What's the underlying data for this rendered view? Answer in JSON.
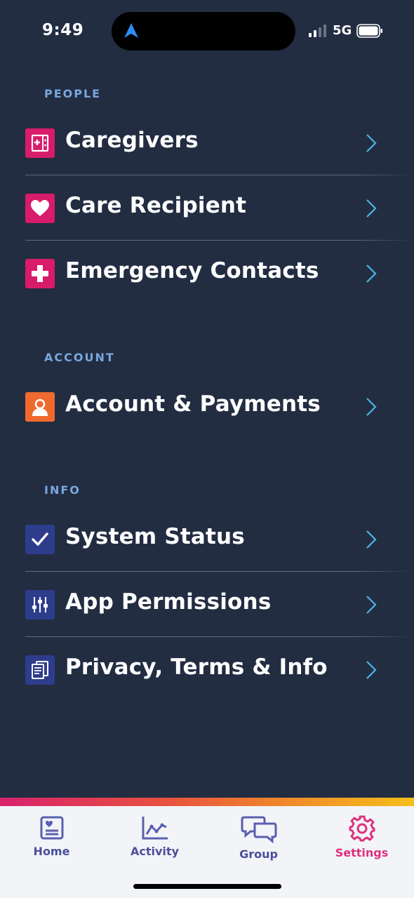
{
  "status_bar": {
    "time": "9:49",
    "network": "5G"
  },
  "sections": [
    {
      "title": "PEOPLE",
      "items": [
        {
          "label": "Caregivers",
          "icon": "caregivers-icon"
        },
        {
          "label": "Care Recipient",
          "icon": "heart-icon"
        },
        {
          "label": "Emergency Contacts",
          "icon": "medical-cross-icon"
        }
      ]
    },
    {
      "title": "ACCOUNT",
      "items": [
        {
          "label": "Account & Payments",
          "icon": "user-icon"
        }
      ]
    },
    {
      "title": "INFO",
      "items": [
        {
          "label": "System Status",
          "icon": "checkmark-icon"
        },
        {
          "label": "App Permissions",
          "icon": "sliders-icon"
        },
        {
          "label": "Privacy, Terms & Info",
          "icon": "document-icon"
        }
      ]
    }
  ],
  "tab_bar": {
    "tabs": [
      {
        "label": "Home",
        "icon": "home-icon"
      },
      {
        "label": "Activity",
        "icon": "activity-chart-icon"
      },
      {
        "label": "Group",
        "icon": "chat-bubbles-icon"
      },
      {
        "label": "Settings",
        "icon": "gear-icon",
        "active": true
      }
    ]
  },
  "colors": {
    "background": "#222d42",
    "accent_pink": "#d81b6a",
    "accent_orange": "#ee6a2e",
    "accent_navy": "#2e3c8c",
    "chevron": "#4fb3e8",
    "active_tab": "#e0307f",
    "tab_text": "#4a4f9a"
  }
}
